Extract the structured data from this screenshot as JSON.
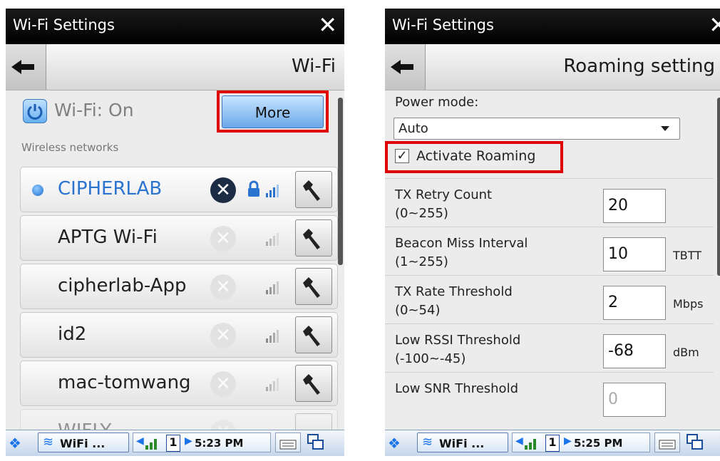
{
  "screens": [
    {
      "title": "Wi-Fi Settings",
      "nav_title": "Wi-Fi",
      "wifi_status": "Wi-Fi: On",
      "more_label": "More",
      "section_label": "Wireless networks",
      "networks": [
        {
          "name": "CIPHERLAB",
          "connected": true
        },
        {
          "name": "APTG Wi-Fi",
          "connected": false
        },
        {
          "name": "cipherlab-App",
          "connected": false
        },
        {
          "name": "id2",
          "connected": false
        },
        {
          "name": "mac-tomwang",
          "connected": false
        },
        {
          "name": "WIFLY",
          "connected": false
        }
      ],
      "taskbar": {
        "app": "WiFi ...",
        "num": "1",
        "time": "5:23 PM"
      }
    },
    {
      "title": "Wi-Fi Settings",
      "nav_title": "Roaming setting",
      "power_mode_label": "Power mode:",
      "power_mode_value": "Auto",
      "activate_roaming_label": "Activate Roaming",
      "activate_roaming_checked": true,
      "fields": [
        {
          "label": "TX Retry Count",
          "range": "(0~255)",
          "value": "20",
          "unit": ""
        },
        {
          "label": "Beacon Miss Interval",
          "range": "(1~255)",
          "value": "10",
          "unit": "TBTT"
        },
        {
          "label": "TX Rate Threshold",
          "range": "(0~54)",
          "value": "2",
          "unit": "Mbps"
        },
        {
          "label": "Low RSSI Threshold",
          "range": "(-100~-45)",
          "value": "-68",
          "unit": "dBm"
        },
        {
          "label": "Low SNR Threshold",
          "range": "",
          "value": "0",
          "unit": ""
        }
      ],
      "taskbar": {
        "app": "WiFi ...",
        "num": "1",
        "time": "5:25 PM"
      }
    }
  ],
  "colors": {
    "highlight": "#e00000",
    "accent": "#2a74d0"
  }
}
